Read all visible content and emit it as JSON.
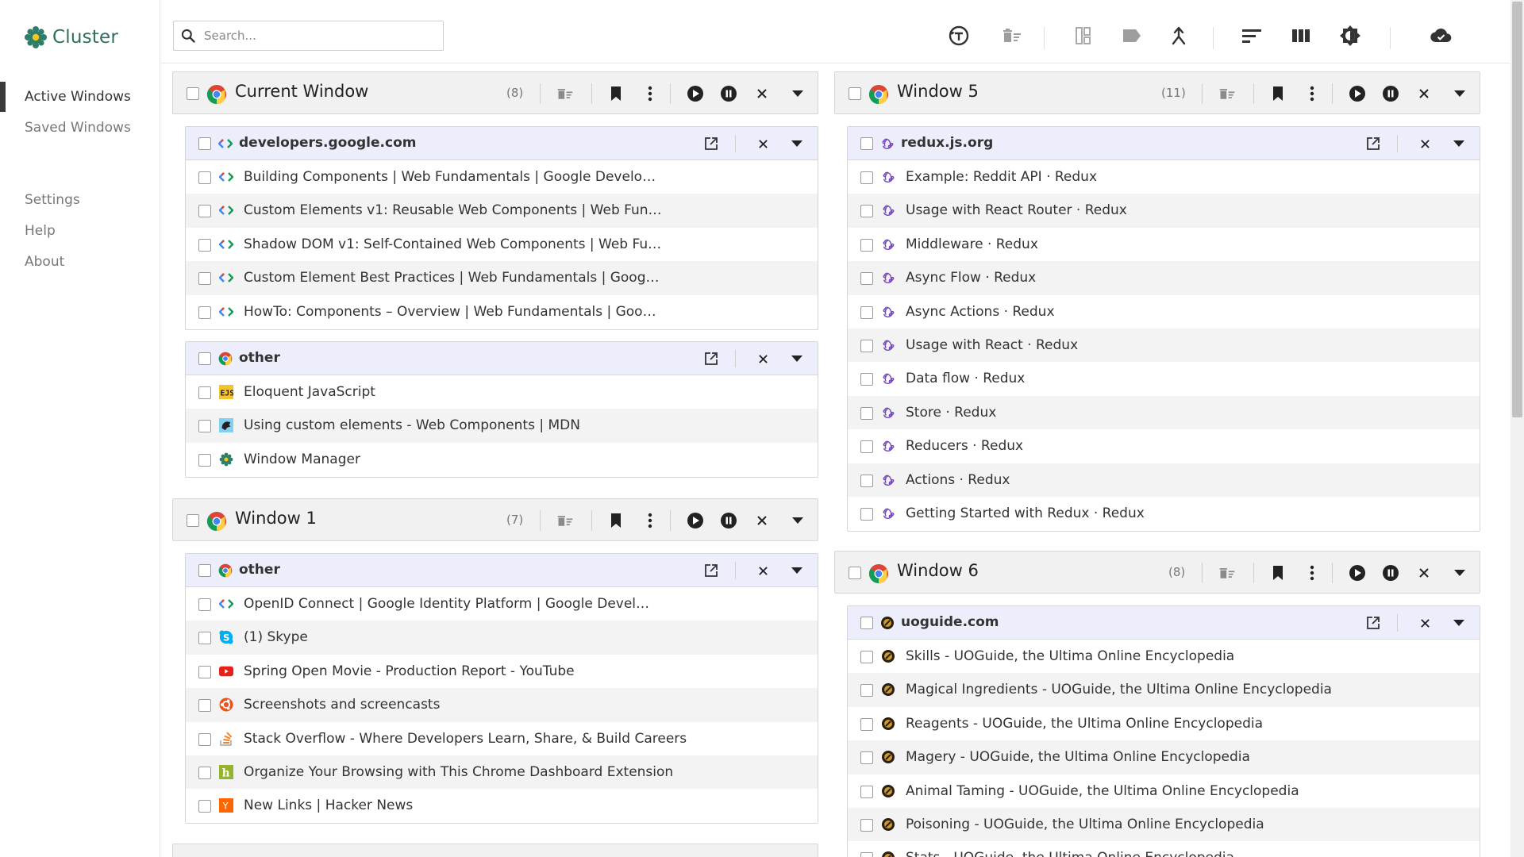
{
  "app": {
    "name": "Cluster",
    "brand_color": "#2e6f62"
  },
  "sidebar": {
    "items": [
      {
        "label": "Active Windows",
        "active": true
      },
      {
        "label": "Saved Windows",
        "active": false
      },
      {
        "label": "Settings",
        "active": false
      },
      {
        "label": "Help",
        "active": false
      },
      {
        "label": "About",
        "active": false
      }
    ]
  },
  "search": {
    "placeholder": "Search..."
  },
  "toolbar": {
    "icons": [
      "history-icon",
      "clear-icon",
      "split-icon",
      "label-icon",
      "merge-icon",
      "sort-icon",
      "columns-icon",
      "theme-icon",
      "cloud-icon"
    ]
  },
  "windows": {
    "current": {
      "title": "Current Window",
      "count": "(8)",
      "groups": [
        {
          "title": "developers.google.com",
          "icon": "google-dev-icon",
          "tabs": [
            "Building Components  |  Web Fundamentals  |  Google Develo…",
            "Custom Elements v1: Reusable Web Components  |  Web Fun…",
            "Shadow DOM v1: Self-Contained Web Components  |  Web Fu…",
            "Custom Element Best Practices  |  Web Fundamentals  |  Goog…",
            "HowTo: Components – Overview  |  Web Fundamentals  |  Goo…"
          ]
        },
        {
          "title": "other",
          "icon": "chrome-icon",
          "tabs": [
            {
              "title": "Eloquent JavaScript",
              "icon": "ejs-icon"
            },
            {
              "title": "Using custom elements - Web Components | MDN",
              "icon": "mdn-icon"
            },
            {
              "title": "Window Manager",
              "icon": "cluster-icon"
            }
          ]
        }
      ]
    },
    "w1": {
      "title": "Window 1",
      "count": "(7)",
      "groups": [
        {
          "title": "other",
          "icon": "chrome-icon",
          "tabs": [
            {
              "title": "OpenID Connect  |  Google Identity Platform  |  Google Devel…",
              "icon": "google-dev-icon"
            },
            {
              "title": "(1) Skype",
              "icon": "skype-icon"
            },
            {
              "title": "Spring Open Movie - Production Report - YouTube",
              "icon": "youtube-icon"
            },
            {
              "title": "Screenshots and screencasts",
              "icon": "ubuntu-icon"
            },
            {
              "title": "Stack Overflow - Where Developers Learn, Share, & Build Careers",
              "icon": "stackoverflow-icon"
            },
            {
              "title": "Organize Your Browsing with This Chrome Dashboard Extension",
              "icon": "lifehacker-icon"
            },
            {
              "title": "New Links | Hacker News",
              "icon": "hackernews-icon"
            }
          ]
        }
      ]
    },
    "w5": {
      "title": "Window 5",
      "count": "(11)",
      "groups": [
        {
          "title": "redux.js.org",
          "icon": "redux-icon",
          "tabs": [
            "Example: Reddit API · Redux",
            "Usage with React Router · Redux",
            "Middleware · Redux",
            "Async Flow · Redux",
            "Async Actions · Redux",
            "Usage with React · Redux",
            "Data flow · Redux",
            "Store · Redux",
            "Reducers · Redux",
            "Actions · Redux",
            "Getting Started with Redux · Redux"
          ]
        }
      ]
    },
    "w6": {
      "title": "Window 6",
      "count": "(8)",
      "groups": [
        {
          "title": "uoguide.com",
          "icon": "uoguide-icon",
          "tabs": [
            "Skills - UOGuide, the Ultima Online Encyclopedia",
            "Magical Ingredients - UOGuide, the Ultima Online Encyclopedia",
            "Reagents - UOGuide, the Ultima Online Encyclopedia",
            "Magery - UOGuide, the Ultima Online Encyclopedia",
            "Animal Taming - UOGuide, the Ultima Online Encyclopedia",
            "Poisoning - UOGuide, the Ultima Online Encyclopedia",
            "Stats - UOGuide, the Ultima Online Encyclopedia"
          ]
        }
      ]
    }
  }
}
